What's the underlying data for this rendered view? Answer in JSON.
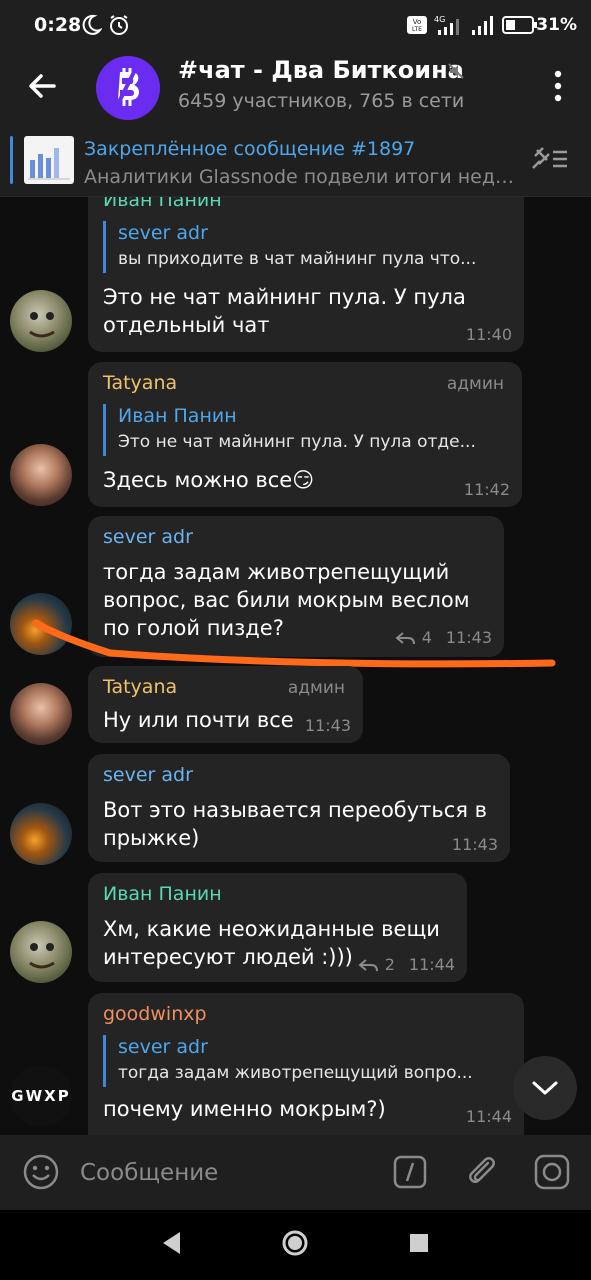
{
  "status_bar": {
    "time": "0:28",
    "battery": "31%"
  },
  "header": {
    "title": "#чат - Два Биткоина",
    "subtitle": "6459 участников, 765 в сети",
    "accent_color": "#6a2cf0"
  },
  "pinned": {
    "title": "Закреплённое сообщение #1897",
    "text": "Аналитики Glassnode подвели итоги неде..."
  },
  "messages": [
    {
      "sender": "Иван Панин",
      "reply": {
        "name": "sever adr",
        "text": "вы приходите в чат майнинг пула что..."
      },
      "text": "Это не чат майнинг пула. У пула\nотдельный чат",
      "time": "11:40"
    },
    {
      "sender": "Tatyana",
      "role": "админ",
      "reply": {
        "name": "Иван Панин",
        "text": "Это не чат майнинг пула. У пула отде..."
      },
      "text": "Здесь можно все😏",
      "time": "11:42"
    },
    {
      "sender": "sever adr",
      "text": "тогда задам животрепещущий\nвопрос, вас били мокрым веслом\nпо голой пизде?",
      "replies": "4",
      "time": "11:43"
    },
    {
      "sender": "Tatyana",
      "role": "админ",
      "text": "Ну или почти все",
      "time": "11:43"
    },
    {
      "sender": "sever adr",
      "text": "Вот это называется переобуться в\nпрыжке)",
      "time": "11:43"
    },
    {
      "sender": "Иван Панин",
      "text": "Хм, какие неожиданные вещи\nинтересуют людей :)))",
      "replies": "2",
      "time": "11:44"
    },
    {
      "sender": "goodwinxp",
      "avatar_text": "GWXP",
      "reply": {
        "name": "sever adr",
        "text": "тогда задам животрепещущий вопро..."
      },
      "text": "почему именно мокрым?)",
      "time": "11:44"
    }
  ],
  "input": {
    "placeholder": "Сообщение"
  },
  "colors": {
    "ivan": "#5ad7b4",
    "tatyana": "#f0c36b",
    "sever": "#6cb3f0",
    "goodwin": "#f08f5f",
    "link": "#4fa6ea",
    "annotation": "#ff6a1a"
  }
}
